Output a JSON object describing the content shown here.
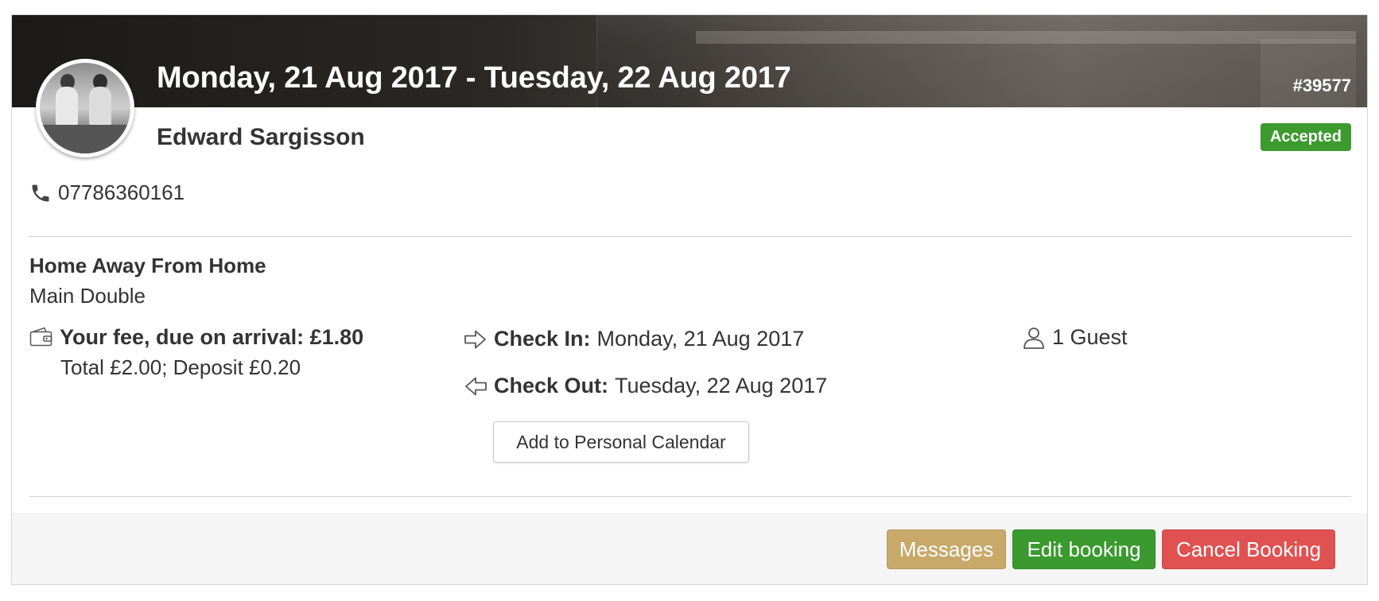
{
  "booking": {
    "dates": "Monday, 21 Aug 2017 - Tuesday, 22 Aug 2017",
    "id": "#39577",
    "guest_name": "Edward Sargisson",
    "status": "Accepted",
    "phone": "07786360161"
  },
  "property": {
    "name": "Home Away From Home",
    "room": "Main Double"
  },
  "fee": {
    "main": "Your fee, due on arrival: £1.80",
    "detail": "Total £2.00; Deposit £0.20"
  },
  "check_in": {
    "label": "Check In:",
    "value": "Monday, 21 Aug 2017"
  },
  "check_out": {
    "label": "Check Out:",
    "value": "Tuesday, 22 Aug 2017"
  },
  "guests": "1 Guest",
  "buttons": {
    "calendar": "Add to Personal Calendar",
    "messages": "Messages",
    "edit": "Edit booking",
    "cancel": "Cancel Booking"
  },
  "colors": {
    "accepted": "#3c9a2f",
    "messages": "#c8a96a",
    "edit": "#3a9a2f",
    "cancel": "#e05252"
  },
  "icons": {
    "phone": "phone-icon",
    "wallet": "wallet-icon",
    "check_in": "arrow-right-icon",
    "check_out": "arrow-left-icon",
    "guest": "user-icon"
  }
}
